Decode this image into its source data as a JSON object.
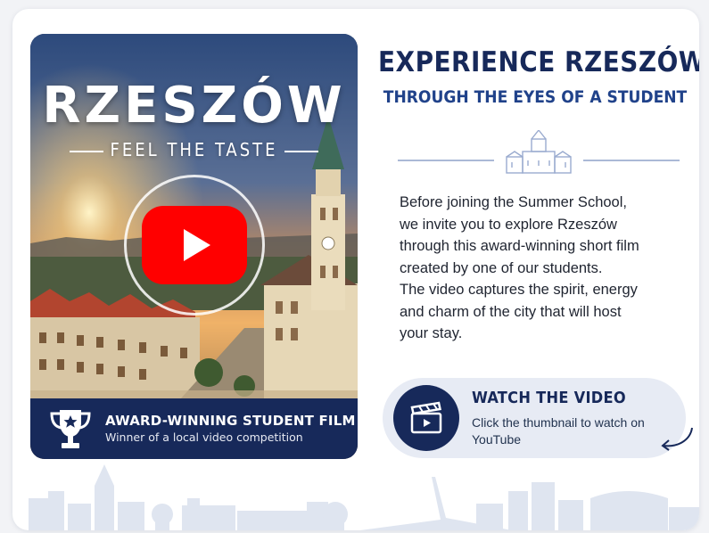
{
  "thumbnail": {
    "title": "RZESZÓW",
    "tagline": "FEEL THE TASTE",
    "play_icon": "youtube-play-icon",
    "award_icon": "trophy-icon",
    "award_title": "AWARD-WINNING STUDENT FILM",
    "award_subtitle": "Winner of a local video competition"
  },
  "heading": {
    "title": "EXPERIENCE RZESZÓW",
    "subtitle": "THROUGH THE EYES OF A STUDENT",
    "divider_icon": "town-hall-icon"
  },
  "description": [
    "Before joining the Summer School,",
    "we invite you to explore Rzeszów",
    "through this award-winning short film",
    "created by one of our students.",
    "The video captures the spirit, energy",
    "and charm of the city that will host",
    "your stay."
  ],
  "cta": {
    "icon": "clapperboard-icon",
    "title": "WATCH THE VIDEO",
    "subtitle": "Click the thumbnail to watch on YouTube",
    "arrow_icon": "curved-arrow-icon"
  },
  "footer": {
    "decoration": "city-skyline"
  },
  "colors": {
    "navy": "#17295a",
    "blue": "#20428a",
    "youtube_red": "#ff0000",
    "cta_bg": "#e7ebf4"
  }
}
